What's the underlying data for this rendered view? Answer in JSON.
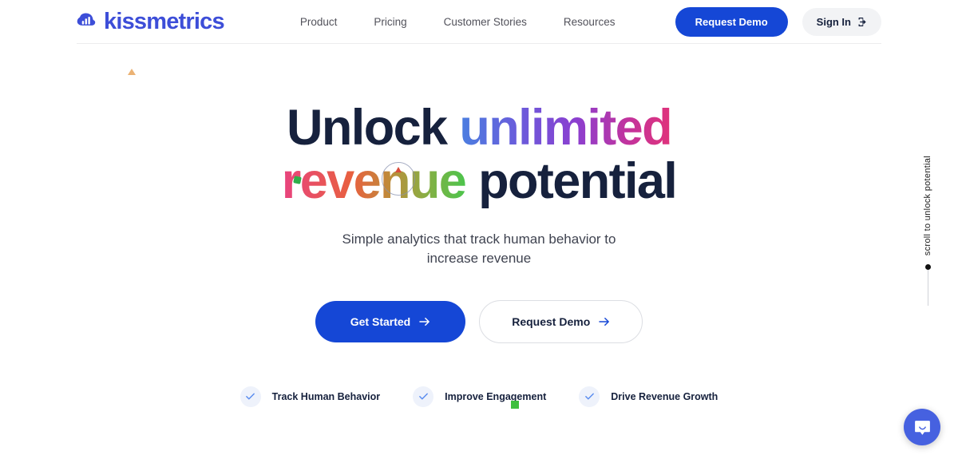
{
  "header": {
    "logo": {
      "icon": "kissmetrics-chart-cloud-icon",
      "name": "kissmetrics"
    },
    "nav": [
      {
        "label": "Product"
      },
      {
        "label": "Pricing"
      },
      {
        "label": "Customer Stories"
      },
      {
        "label": "Resources"
      }
    ],
    "request_demo_label": "Request Demo",
    "sign_in_label": "Sign In",
    "sign_in_icon": "sign-in-arrow-icon"
  },
  "hero": {
    "headline": {
      "line1_dark": "Unlock",
      "line1_gradient": "unlimited",
      "line2_gradient": "revenue",
      "line2_dark": "potential"
    },
    "subtitle_line1": "Simple analytics that track human behavior to",
    "subtitle_line2": "increase revenue",
    "cta_primary": "Get Started",
    "cta_secondary": "Request Demo",
    "arrow_icon": "arrow-right-icon"
  },
  "features": [
    {
      "label": "Track Human Behavior",
      "icon": "check-icon"
    },
    {
      "label": "Improve Engagement",
      "icon": "check-icon"
    },
    {
      "label": "Drive Revenue Growth",
      "icon": "check-icon"
    }
  ],
  "scroll_indicator": {
    "text": "scroll to unlock potential"
  },
  "chat_widget": {
    "icon": "chat-bubble-smile-icon"
  },
  "colors": {
    "brand_indigo": "#3d4ed8",
    "primary_blue": "#1547d6",
    "dark_navy": "#16213d",
    "body_gray": "#3f4350",
    "check_blue": "#5b8def",
    "chat_blue": "#4661e0",
    "accent_green": "#3fbf3f",
    "accent_orange": "#e8a45c",
    "gradient_unlimited_start": "#4a7fe0",
    "gradient_unlimited_mid": "#8b3fd0",
    "gradient_unlimited_end": "#e0337a",
    "gradient_revenue_start": "#e8437f",
    "gradient_revenue_mid": "#e8603f",
    "gradient_revenue_end": "#4cc44c"
  }
}
